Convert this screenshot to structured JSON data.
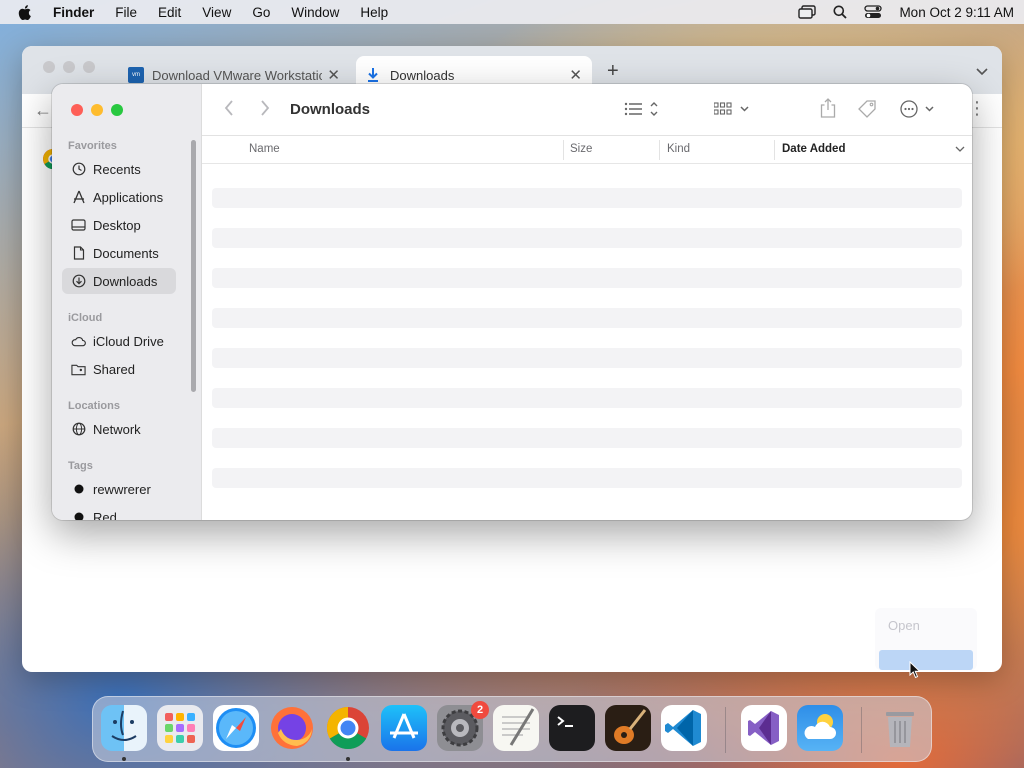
{
  "menubar": {
    "app_name": "Finder",
    "items": [
      "File",
      "Edit",
      "View",
      "Go",
      "Window",
      "Help"
    ],
    "clock": "Mon Oct 2  9:11 AM"
  },
  "browser": {
    "tabs": [
      {
        "title": "Download VMware Workstatic"
      },
      {
        "title": "Downloads"
      }
    ]
  },
  "context_menu": {
    "open_label": "Open"
  },
  "finder": {
    "title": "Downloads",
    "sidebar": {
      "favorites_header": "Favorites",
      "favorites": [
        "Recents",
        "Applications",
        "Desktop",
        "Documents",
        "Downloads"
      ],
      "icloud_header": "iCloud",
      "icloud": [
        "iCloud Drive",
        "Shared"
      ],
      "locations_header": "Locations",
      "locations": [
        "Network"
      ],
      "tags_header": "Tags",
      "tags": [
        "rewwrerer",
        "Red"
      ]
    },
    "columns": [
      "Name",
      "Size",
      "Kind",
      "Date Added"
    ],
    "sorted_column": "Date Added"
  },
  "dock": {
    "apps": [
      "Finder",
      "Launchpad",
      "Safari",
      "Firefox",
      "Google Chrome",
      "App Store",
      "System Settings",
      "TextEdit",
      "Terminal",
      "GarageBand",
      "Visual Studio Code",
      "Visual Studio",
      "Weather",
      "Trash"
    ],
    "system_settings_badge": "2"
  },
  "colors": {
    "close": "#fe5f57",
    "minimize": "#febc2e",
    "zoom": "#28c840",
    "accent": "#0a64d6"
  }
}
